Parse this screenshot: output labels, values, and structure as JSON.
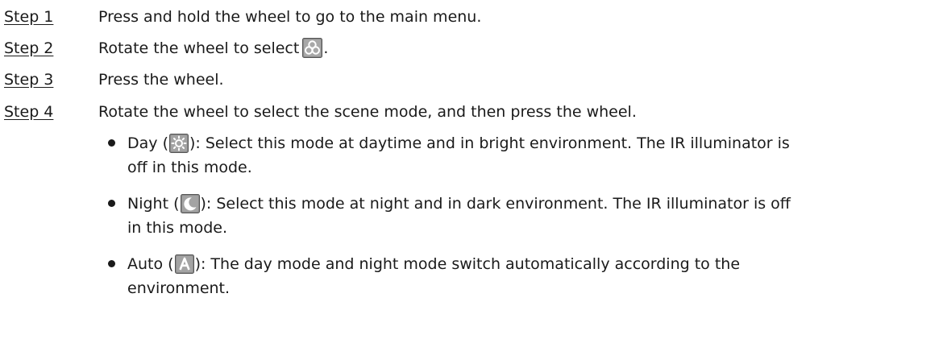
{
  "steps": [
    {
      "label": "Step 1",
      "text": "Press and hold the wheel to go to the main menu."
    },
    {
      "label": "Step 2",
      "text": "Rotate the wheel to select",
      "text_after_icon": ".",
      "icon": "scene-mode-icon"
    },
    {
      "label": "Step 3",
      "text": "Press the wheel."
    },
    {
      "label": "Step 4",
      "text": "Rotate the wheel to select the scene mode, and then press the wheel."
    }
  ],
  "modes": [
    {
      "name": "Day",
      "icon": "day-mode-icon",
      "line1": "): Select this mode at daytime and in bright environment. The IR illuminator is",
      "line2": "off in this mode."
    },
    {
      "name": "Night",
      "icon": "night-mode-icon",
      "line1": "): Select this mode at night and in dark environment. The IR illuminator is off",
      "line2": "in this mode."
    },
    {
      "name": "Auto",
      "icon": "auto-mode-icon",
      "line1": "): The day mode and night mode switch automatically according to the",
      "line2": "environment."
    }
  ],
  "icon_colors": {
    "frame": "#5a5a5a",
    "fill": "#9a9a9a",
    "glyph": "#ffffff"
  }
}
